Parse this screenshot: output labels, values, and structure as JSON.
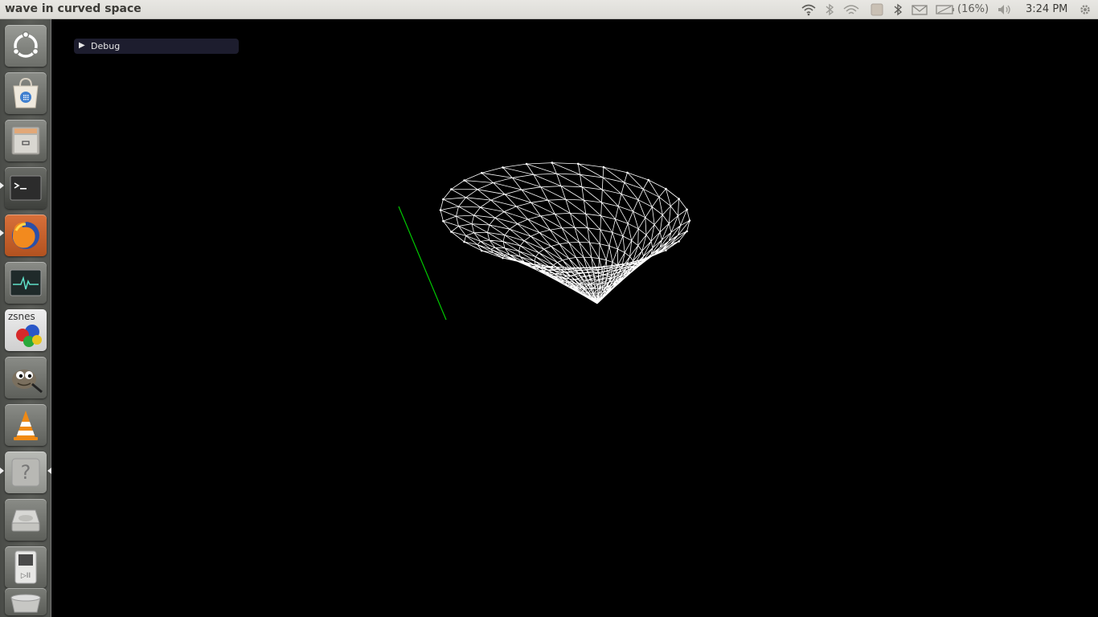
{
  "window": {
    "title": "wave in curved space"
  },
  "panel": {
    "battery_percent": "(16%)",
    "clock": "3:24 PM"
  },
  "launcher": {
    "items": [
      {
        "icon": "ubuntu-dash-icon",
        "running": false
      },
      {
        "icon": "software-center-icon",
        "running": false
      },
      {
        "icon": "files-icon",
        "running": false
      },
      {
        "icon": "terminal-icon",
        "running": true
      },
      {
        "icon": "firefox-icon",
        "running": true
      },
      {
        "icon": "system-monitor-icon",
        "running": false
      },
      {
        "icon": "zsnes-icon",
        "label": "zsnes",
        "running": false
      },
      {
        "icon": "gimp-icon",
        "running": false
      },
      {
        "icon": "vlc-icon",
        "running": false
      },
      {
        "icon": "help-icon",
        "label": "?",
        "running": true
      },
      {
        "icon": "drive-icon",
        "running": false
      },
      {
        "icon": "media-player-icon",
        "running": false
      },
      {
        "icon": "trash-icon",
        "running": false
      }
    ]
  },
  "debug": {
    "label": "Debug",
    "arrow": "▶"
  },
  "scene": {
    "mesh_color": "#ffffff",
    "axis_color": "#00c800"
  }
}
